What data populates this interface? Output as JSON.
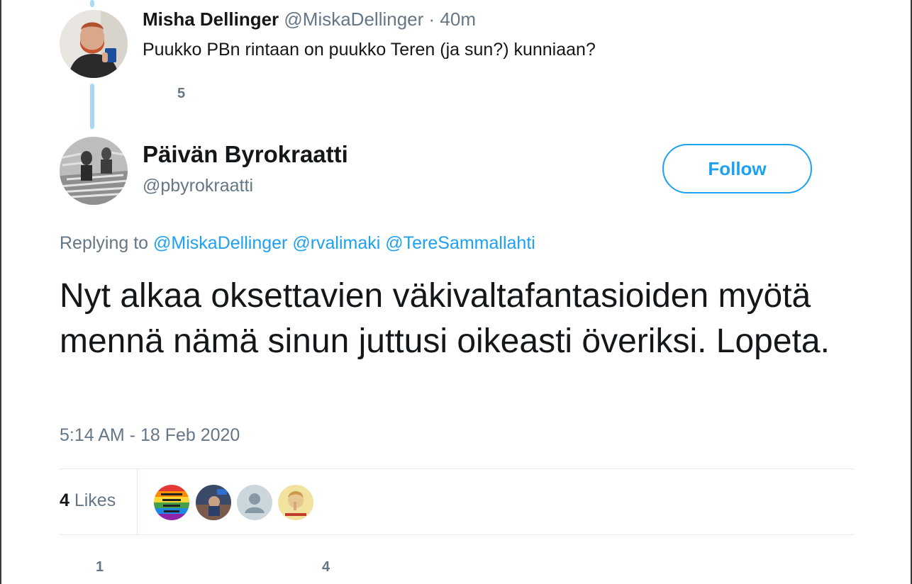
{
  "parent_tweet": {
    "name": "Misha Dellinger",
    "handle": "@MiskaDellinger",
    "time": " · 40m",
    "text": "Puukko PBn rintaan on puukko Teren (ja sun?) kunniaan?",
    "reply_count": "5"
  },
  "main_tweet": {
    "name": "Päivän Byrokraatti",
    "handle": "@pbyrokraatti",
    "follow_label": "Follow",
    "replying_prefix": "Replying to ",
    "mentions": [
      "@MiskaDellinger",
      "@rvalimaki",
      "@TereSammallahti"
    ],
    "text": "Nyt alkaa oksettavien väkivaltafantasioiden myötä mennä nämä sinun juttusi oikeasti överiksi. Lopeta.",
    "timestamp": "5:14 AM - 18 Feb 2020",
    "likes_count": "4",
    "likes_label": " Likes",
    "reply_count": "1",
    "like_count_bottom": "4"
  },
  "colors": {
    "accent": "#1da1f2",
    "thread_line": "#a9d7f4",
    "secondary_text": "#657786"
  }
}
